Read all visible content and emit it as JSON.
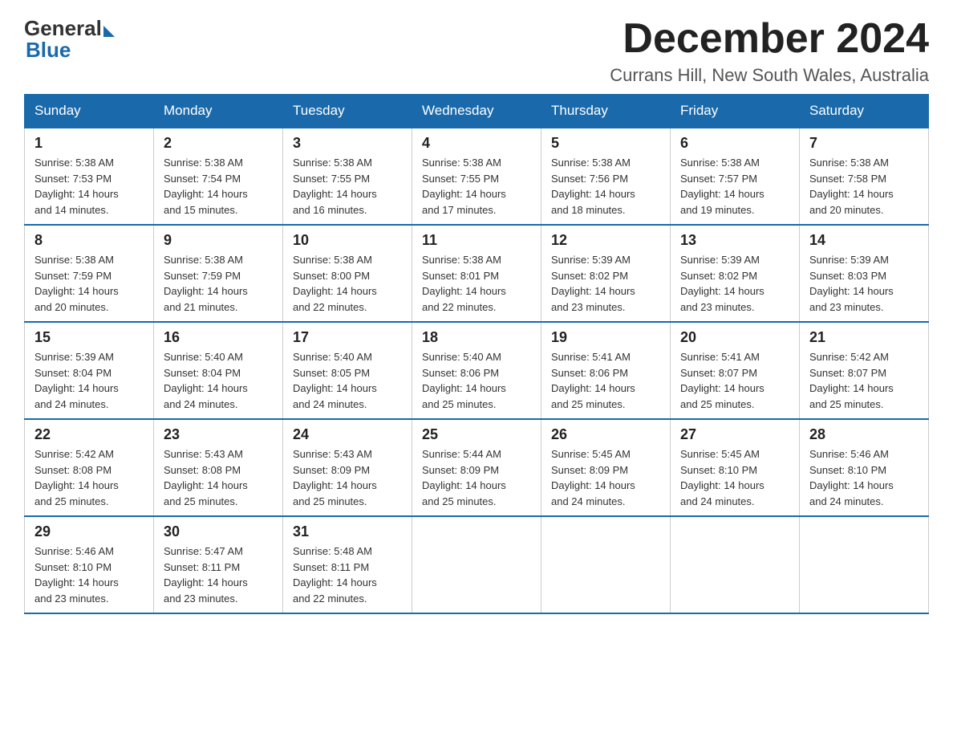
{
  "logo": {
    "general": "General",
    "blue": "Blue"
  },
  "header": {
    "month": "December 2024",
    "location": "Currans Hill, New South Wales, Australia"
  },
  "days_of_week": [
    "Sunday",
    "Monday",
    "Tuesday",
    "Wednesday",
    "Thursday",
    "Friday",
    "Saturday"
  ],
  "weeks": [
    [
      {
        "day": "1",
        "sunrise": "5:38 AM",
        "sunset": "7:53 PM",
        "daylight": "14 hours and 14 minutes."
      },
      {
        "day": "2",
        "sunrise": "5:38 AM",
        "sunset": "7:54 PM",
        "daylight": "14 hours and 15 minutes."
      },
      {
        "day": "3",
        "sunrise": "5:38 AM",
        "sunset": "7:55 PM",
        "daylight": "14 hours and 16 minutes."
      },
      {
        "day": "4",
        "sunrise": "5:38 AM",
        "sunset": "7:55 PM",
        "daylight": "14 hours and 17 minutes."
      },
      {
        "day": "5",
        "sunrise": "5:38 AM",
        "sunset": "7:56 PM",
        "daylight": "14 hours and 18 minutes."
      },
      {
        "day": "6",
        "sunrise": "5:38 AM",
        "sunset": "7:57 PM",
        "daylight": "14 hours and 19 minutes."
      },
      {
        "day": "7",
        "sunrise": "5:38 AM",
        "sunset": "7:58 PM",
        "daylight": "14 hours and 20 minutes."
      }
    ],
    [
      {
        "day": "8",
        "sunrise": "5:38 AM",
        "sunset": "7:59 PM",
        "daylight": "14 hours and 20 minutes."
      },
      {
        "day": "9",
        "sunrise": "5:38 AM",
        "sunset": "7:59 PM",
        "daylight": "14 hours and 21 minutes."
      },
      {
        "day": "10",
        "sunrise": "5:38 AM",
        "sunset": "8:00 PM",
        "daylight": "14 hours and 22 minutes."
      },
      {
        "day": "11",
        "sunrise": "5:38 AM",
        "sunset": "8:01 PM",
        "daylight": "14 hours and 22 minutes."
      },
      {
        "day": "12",
        "sunrise": "5:39 AM",
        "sunset": "8:02 PM",
        "daylight": "14 hours and 23 minutes."
      },
      {
        "day": "13",
        "sunrise": "5:39 AM",
        "sunset": "8:02 PM",
        "daylight": "14 hours and 23 minutes."
      },
      {
        "day": "14",
        "sunrise": "5:39 AM",
        "sunset": "8:03 PM",
        "daylight": "14 hours and 23 minutes."
      }
    ],
    [
      {
        "day": "15",
        "sunrise": "5:39 AM",
        "sunset": "8:04 PM",
        "daylight": "14 hours and 24 minutes."
      },
      {
        "day": "16",
        "sunrise": "5:40 AM",
        "sunset": "8:04 PM",
        "daylight": "14 hours and 24 minutes."
      },
      {
        "day": "17",
        "sunrise": "5:40 AM",
        "sunset": "8:05 PM",
        "daylight": "14 hours and 24 minutes."
      },
      {
        "day": "18",
        "sunrise": "5:40 AM",
        "sunset": "8:06 PM",
        "daylight": "14 hours and 25 minutes."
      },
      {
        "day": "19",
        "sunrise": "5:41 AM",
        "sunset": "8:06 PM",
        "daylight": "14 hours and 25 minutes."
      },
      {
        "day": "20",
        "sunrise": "5:41 AM",
        "sunset": "8:07 PM",
        "daylight": "14 hours and 25 minutes."
      },
      {
        "day": "21",
        "sunrise": "5:42 AM",
        "sunset": "8:07 PM",
        "daylight": "14 hours and 25 minutes."
      }
    ],
    [
      {
        "day": "22",
        "sunrise": "5:42 AM",
        "sunset": "8:08 PM",
        "daylight": "14 hours and 25 minutes."
      },
      {
        "day": "23",
        "sunrise": "5:43 AM",
        "sunset": "8:08 PM",
        "daylight": "14 hours and 25 minutes."
      },
      {
        "day": "24",
        "sunrise": "5:43 AM",
        "sunset": "8:09 PM",
        "daylight": "14 hours and 25 minutes."
      },
      {
        "day": "25",
        "sunrise": "5:44 AM",
        "sunset": "8:09 PM",
        "daylight": "14 hours and 25 minutes."
      },
      {
        "day": "26",
        "sunrise": "5:45 AM",
        "sunset": "8:09 PM",
        "daylight": "14 hours and 24 minutes."
      },
      {
        "day": "27",
        "sunrise": "5:45 AM",
        "sunset": "8:10 PM",
        "daylight": "14 hours and 24 minutes."
      },
      {
        "day": "28",
        "sunrise": "5:46 AM",
        "sunset": "8:10 PM",
        "daylight": "14 hours and 24 minutes."
      }
    ],
    [
      {
        "day": "29",
        "sunrise": "5:46 AM",
        "sunset": "8:10 PM",
        "daylight": "14 hours and 23 minutes."
      },
      {
        "day": "30",
        "sunrise": "5:47 AM",
        "sunset": "8:11 PM",
        "daylight": "14 hours and 23 minutes."
      },
      {
        "day": "31",
        "sunrise": "5:48 AM",
        "sunset": "8:11 PM",
        "daylight": "14 hours and 22 minutes."
      },
      null,
      null,
      null,
      null
    ]
  ],
  "labels": {
    "sunrise": "Sunrise:",
    "sunset": "Sunset:",
    "daylight": "Daylight:"
  }
}
